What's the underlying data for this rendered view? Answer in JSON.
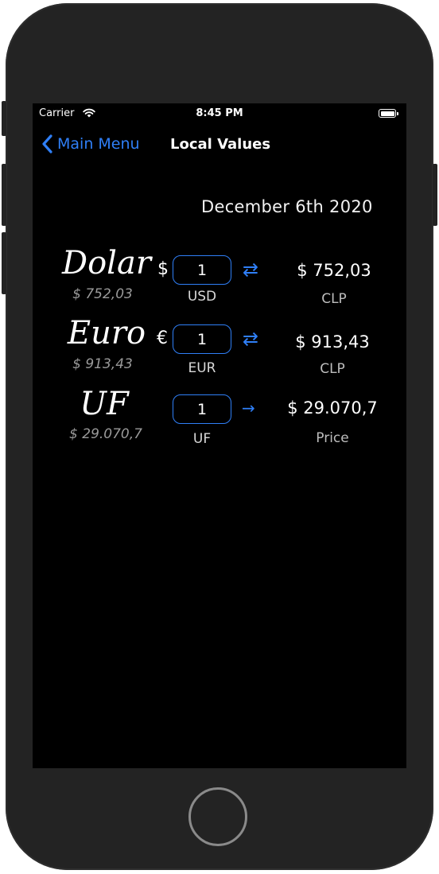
{
  "status_bar": {
    "carrier": "Carrier",
    "time": "8:45 PM"
  },
  "nav": {
    "back_label": "Main Menu",
    "title": "Local Values"
  },
  "date": "December 6th 2020",
  "accent_color": "#2f7ff7",
  "icons": {
    "back": "chevron-left-icon",
    "swap": "swap-arrows-icon",
    "convert": "right-arrow-icon",
    "wifi": "wifi-icon",
    "battery": "battery-icon"
  },
  "rows": [
    {
      "name": "Dolar",
      "rate": "$ 752,03",
      "symbol": "$",
      "input_value": "1",
      "code": "USD",
      "arrow": "⇄",
      "result": "$ 752,03",
      "result_label": "CLP"
    },
    {
      "name": "Euro",
      "rate": "$ 913,43",
      "symbol": "€",
      "input_value": "1",
      "code": "EUR",
      "arrow": "⇄",
      "result": "$ 913,43",
      "result_label": "CLP"
    },
    {
      "name": "UF",
      "rate": "$ 29.070,7",
      "symbol": "",
      "input_value": "1",
      "code": "UF",
      "arrow": "→",
      "result": "$ 29.070,7",
      "result_label": "Price"
    }
  ]
}
